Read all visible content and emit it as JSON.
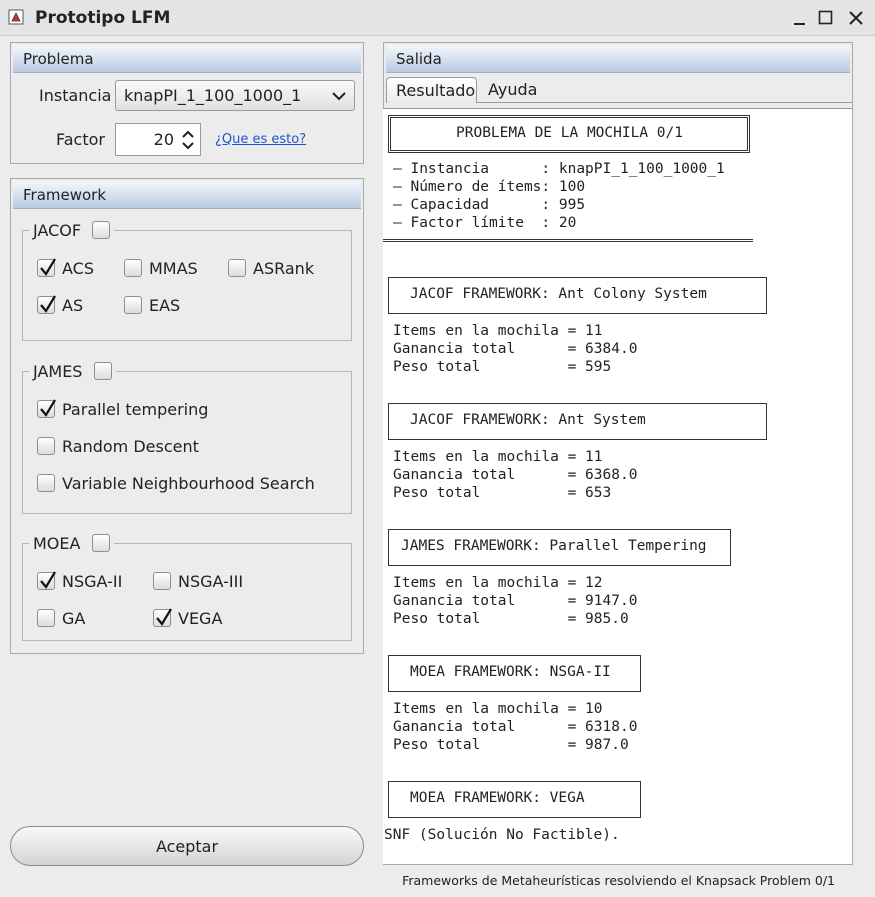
{
  "window": {
    "title": "Prototipo LFM"
  },
  "problema": {
    "header": "Problema",
    "instancia_label": "Instancia",
    "instancia_value": "knapPI_1_100_1000_1",
    "factor_label": "Factor",
    "factor_value": "20",
    "help_link": "¿Que es esto?"
  },
  "framework": {
    "header": "Framework",
    "jacof": {
      "label": "JACOF",
      "checked": false,
      "options": [
        {
          "label": "ACS",
          "checked": true
        },
        {
          "label": "MMAS",
          "checked": false
        },
        {
          "label": "ASRank",
          "checked": false
        },
        {
          "label": "AS",
          "checked": true
        },
        {
          "label": "EAS",
          "checked": false
        }
      ]
    },
    "james": {
      "label": "JAMES",
      "checked": false,
      "options": [
        {
          "label": "Parallel tempering",
          "checked": true
        },
        {
          "label": "Random Descent",
          "checked": false
        },
        {
          "label": "Variable Neighbourhood Search",
          "checked": false
        }
      ]
    },
    "moea": {
      "label": "MOEA",
      "checked": false,
      "options": [
        {
          "label": "NSGA-II",
          "checked": true
        },
        {
          "label": "NSGA-III",
          "checked": false
        },
        {
          "label": "GA",
          "checked": false
        },
        {
          "label": "VEGA",
          "checked": true
        }
      ]
    }
  },
  "accept_button": "Aceptar",
  "salida": {
    "header": "Salida",
    "tabs": [
      "Resultado",
      "Ayuda"
    ],
    "title": "PROBLEMA DE LA MOCHILA 0/1",
    "summary": [
      "– Instancia      : knapPI_1_100_1000_1",
      "– Número de ítems: 100",
      "– Capacidad      : 995",
      "– Factor límite  : 20"
    ],
    "results": [
      {
        "heading": "JACOF FRAMEWORK: Ant Colony System",
        "lines": [
          "Items en la mochila = 11",
          "Ganancia total      = 6384.0",
          "Peso total          = 595"
        ]
      },
      {
        "heading": "JACOF FRAMEWORK: Ant System",
        "lines": [
          "Items en la mochila = 11",
          "Ganancia total      = 6368.0",
          "Peso total          = 653"
        ]
      },
      {
        "heading": "JAMES FRAMEWORK: Parallel Tempering",
        "lines": [
          "Items en la mochila = 12",
          "Ganancia total      = 9147.0",
          "Peso total          = 985.0"
        ]
      },
      {
        "heading": "MOEA FRAMEWORK: NSGA-II",
        "lines": [
          "Items en la mochila = 10",
          "Ganancia total      = 6318.0",
          "Peso total          = 987.0"
        ]
      },
      {
        "heading": "MOEA FRAMEWORK: VEGA",
        "lines": [
          "SNF (Solución No Factible)."
        ]
      }
    ]
  },
  "status": "Frameworks de Metaheurísticas resolviendo el Knapsack Problem 0/1"
}
